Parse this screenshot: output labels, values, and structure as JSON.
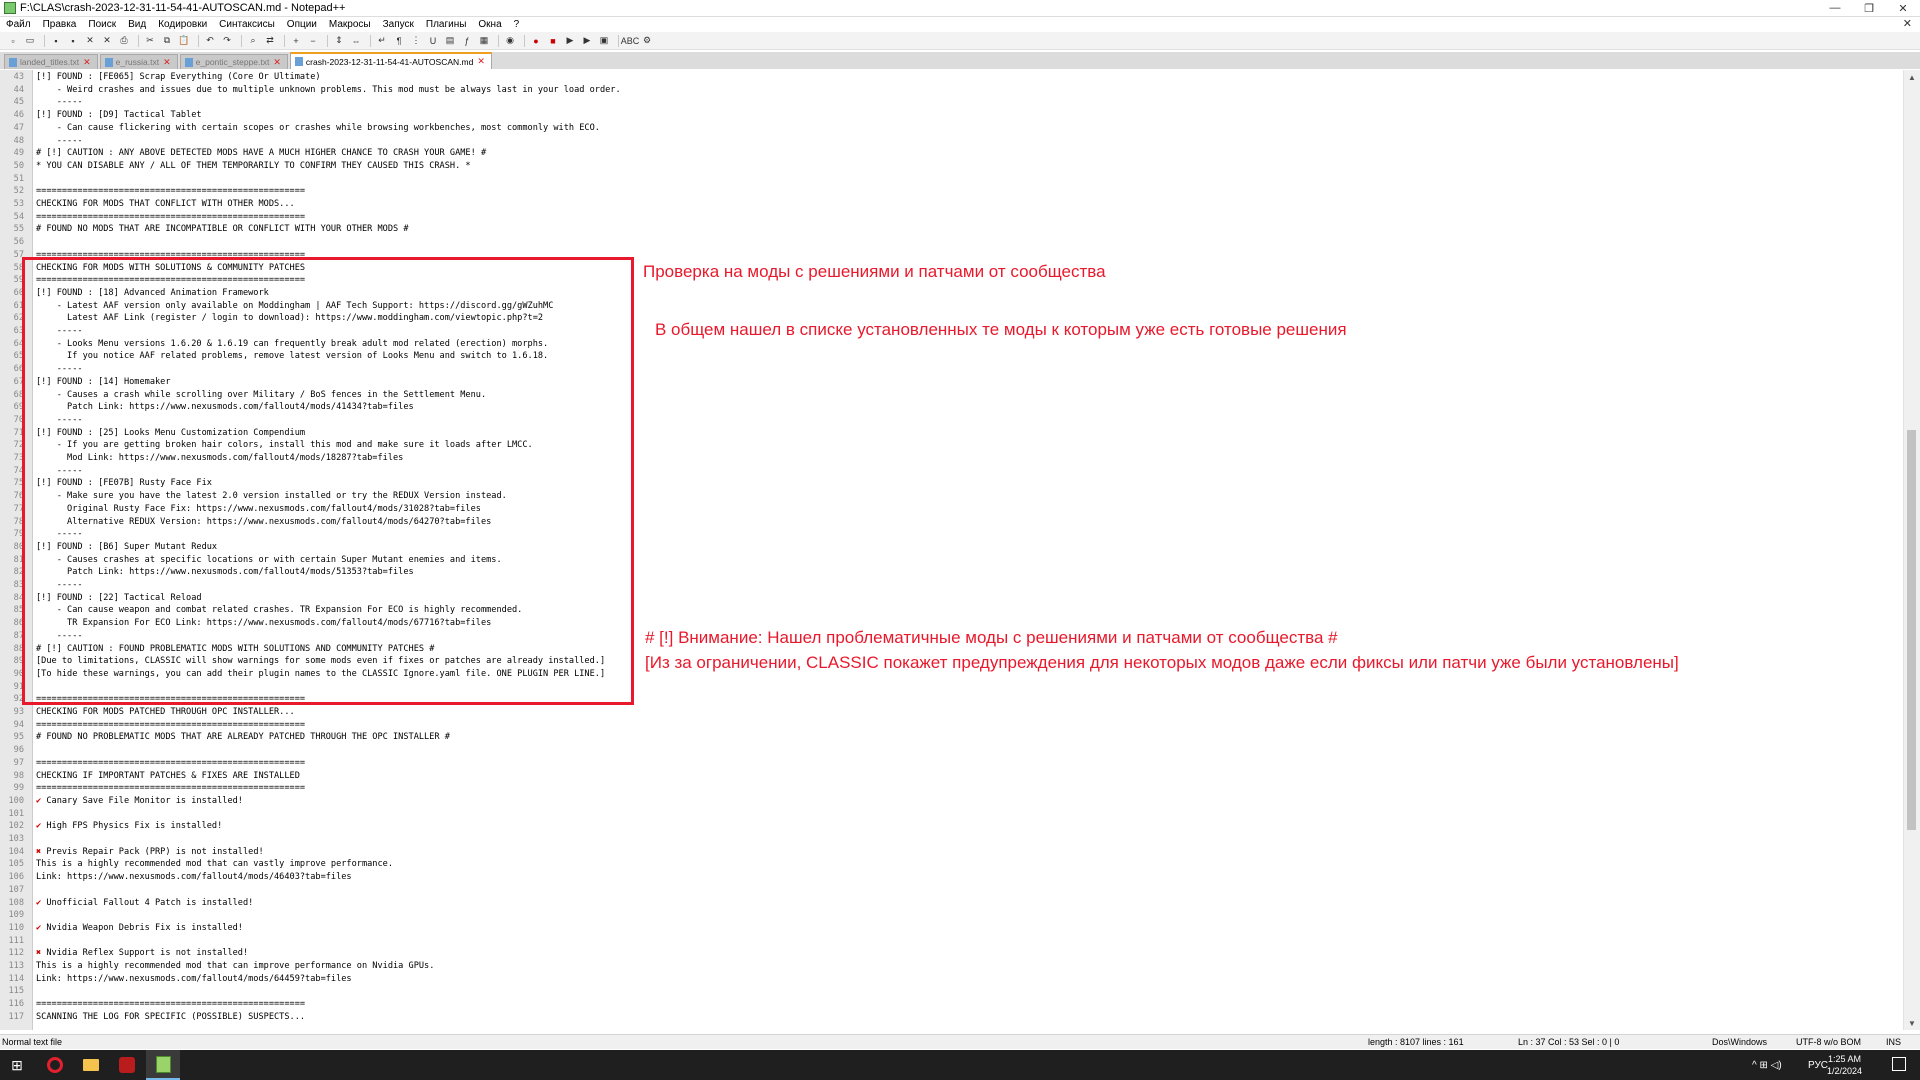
{
  "window": {
    "title": "F:\\CLAS\\crash-2023-12-31-11-54-41-AUTOSCAN.md - Notepad++",
    "minimize": "—",
    "maximize": "❐",
    "close": "✕"
  },
  "menu": {
    "items": [
      "Файл",
      "Правка",
      "Поиск",
      "Вид",
      "Кодировки",
      "Синтаксисы",
      "Опции",
      "Макросы",
      "Запуск",
      "Плагины",
      "Окна",
      "?"
    ],
    "close_doc": "✕"
  },
  "toolbar": {
    "icons": [
      "new-file-icon",
      "open-file-icon",
      "save-icon",
      "save-all-icon",
      "close-icon",
      "close-all-icon",
      "print-icon",
      "cut-icon",
      "copy-icon",
      "paste-icon",
      "undo-icon",
      "redo-icon",
      "find-icon",
      "replace-icon",
      "zoom-in-icon",
      "zoom-out-icon",
      "sync-v-icon",
      "sync-h-icon",
      "wrap-icon",
      "all-chars-icon",
      "indent-guide-icon",
      "udl-icon",
      "doc-map-icon",
      "function-list-icon",
      "folder-as-workspace-icon",
      "monitor-icon",
      "record-icon",
      "stop-icon",
      "play-icon",
      "play-multiple-icon",
      "save-macro-icon",
      "spellcheck-icon",
      "plugin-icon"
    ]
  },
  "tabs": [
    {
      "label": "landed_titles.txt",
      "active": false
    },
    {
      "label": "e_russia.txt",
      "active": false
    },
    {
      "label": "e_pontic_steppe.txt",
      "active": false
    },
    {
      "label": "crash-2023-12-31-11-54-41-AUTOSCAN.md",
      "active": true
    }
  ],
  "lines": [
    {
      "n": "43",
      "t": "[!] FOUND : [FE065] Scrap Everything (Core Or Ultimate)"
    },
    {
      "n": "44",
      "t": "    - Weird crashes and issues due to multiple unknown problems. This mod must be always last in your load order."
    },
    {
      "n": "45",
      "t": "    -----"
    },
    {
      "n": "46",
      "t": "[!] FOUND : [D9] Tactical Tablet"
    },
    {
      "n": "47",
      "t": "    - Can cause flickering with certain scopes or crashes while browsing workbenches, most commonly with ECO."
    },
    {
      "n": "48",
      "t": "    -----"
    },
    {
      "n": "49",
      "t": "# [!] CAUTION : ANY ABOVE DETECTED MODS HAVE A MUCH HIGHER CHANCE TO CRASH YOUR GAME! #"
    },
    {
      "n": "50",
      "t": "* YOU CAN DISABLE ANY / ALL OF THEM TEMPORARILY TO CONFIRM THEY CAUSED THIS CRASH. *"
    },
    {
      "n": "51",
      "t": ""
    },
    {
      "n": "52",
      "t": "===================================================="
    },
    {
      "n": "53",
      "t": "CHECKING FOR MODS THAT CONFLICT WITH OTHER MODS..."
    },
    {
      "n": "54",
      "t": "===================================================="
    },
    {
      "n": "55",
      "t": "# FOUND NO MODS THAT ARE INCOMPATIBLE OR CONFLICT WITH YOUR OTHER MODS #"
    },
    {
      "n": "56",
      "t": ""
    },
    {
      "n": "57",
      "t": "===================================================="
    },
    {
      "n": "58",
      "t": "CHECKING FOR MODS WITH SOLUTIONS & COMMUNITY PATCHES"
    },
    {
      "n": "59",
      "t": "===================================================="
    },
    {
      "n": "60",
      "t": "[!] FOUND : [18] Advanced Animation Framework"
    },
    {
      "n": "61",
      "t": "    - Latest AAF version only available on Moddingham | AAF Tech Support: https://discord.gg/gWZuhMC"
    },
    {
      "n": "62",
      "t": "      Latest AAF Link (register / login to download): https://www.moddingham.com/viewtopic.php?t=2"
    },
    {
      "n": "63",
      "t": "    -----"
    },
    {
      "n": "64",
      "t": "    - Looks Menu versions 1.6.20 & 1.6.19 can frequently break adult mod related (erection) morphs."
    },
    {
      "n": "65",
      "t": "      If you notice AAF related problems, remove latest version of Looks Menu and switch to 1.6.18."
    },
    {
      "n": "66",
      "t": "    -----"
    },
    {
      "n": "67",
      "t": "[!] FOUND : [14] Homemaker"
    },
    {
      "n": "68",
      "t": "    - Causes a crash while scrolling over Military / BoS fences in the Settlement Menu."
    },
    {
      "n": "69",
      "t": "      Patch Link: https://www.nexusmods.com/fallout4/mods/41434?tab=files"
    },
    {
      "n": "70",
      "t": "    -----"
    },
    {
      "n": "71",
      "t": "[!] FOUND : [25] Looks Menu Customization Compendium"
    },
    {
      "n": "72",
      "t": "    - If you are getting broken hair colors, install this mod and make sure it loads after LMCC."
    },
    {
      "n": "73",
      "t": "      Mod Link: https://www.nexusmods.com/fallout4/mods/18287?tab=files"
    },
    {
      "n": "74",
      "t": "    -----"
    },
    {
      "n": "75",
      "t": "[!] FOUND : [FE07B] Rusty Face Fix"
    },
    {
      "n": "76",
      "t": "    - Make sure you have the latest 2.0 version installed or try the REDUX Version instead."
    },
    {
      "n": "77",
      "t": "      Original Rusty Face Fix: https://www.nexusmods.com/fallout4/mods/31028?tab=files"
    },
    {
      "n": "78",
      "t": "      Alternative REDUX Version: https://www.nexusmods.com/fallout4/mods/64270?tab=files"
    },
    {
      "n": "79",
      "t": "    -----"
    },
    {
      "n": "80",
      "t": "[!] FOUND : [B6] Super Mutant Redux"
    },
    {
      "n": "81",
      "t": "    - Causes crashes at specific locations or with certain Super Mutant enemies and items."
    },
    {
      "n": "82",
      "t": "      Patch Link: https://www.nexusmods.com/fallout4/mods/51353?tab=files"
    },
    {
      "n": "83",
      "t": "    -----"
    },
    {
      "n": "84",
      "t": "[!] FOUND : [22] Tactical Reload"
    },
    {
      "n": "85",
      "t": "    - Can cause weapon and combat related crashes. TR Expansion For ECO is highly recommended."
    },
    {
      "n": "86",
      "t": "      TR Expansion For ECO Link: https://www.nexusmods.com/fallout4/mods/67716?tab=files"
    },
    {
      "n": "87",
      "t": "    -----"
    },
    {
      "n": "88",
      "t": "# [!] CAUTION : FOUND PROBLEMATIC MODS WITH SOLUTIONS AND COMMUNITY PATCHES #"
    },
    {
      "n": "89",
      "t": "[Due to limitations, CLASSIC will show warnings for some mods even if fixes or patches are already installed.]"
    },
    {
      "n": "90",
      "t": "[To hide these warnings, you can add their plugin names to the CLASSIC Ignore.yaml file. ONE PLUGIN PER LINE.]"
    },
    {
      "n": "91",
      "t": ""
    },
    {
      "n": "92",
      "t": "===================================================="
    },
    {
      "n": "93",
      "t": "CHECKING FOR MODS PATCHED THROUGH OPC INSTALLER..."
    },
    {
      "n": "94",
      "t": "===================================================="
    },
    {
      "n": "95",
      "t": "# FOUND NO PROBLEMATIC MODS THAT ARE ALREADY PATCHED THROUGH THE OPC INSTALLER #"
    },
    {
      "n": "96",
      "t": ""
    },
    {
      "n": "97",
      "t": "===================================================="
    },
    {
      "n": "98",
      "t": "CHECKING IF IMPORTANT PATCHES & FIXES ARE INSTALLED"
    },
    {
      "n": "99",
      "t": "===================================================="
    },
    {
      "n": "100",
      "t": "✔ Canary Save File Monitor is installed!"
    },
    {
      "n": "101",
      "t": ""
    },
    {
      "n": "102",
      "t": "✔ High FPS Physics Fix is installed!"
    },
    {
      "n": "103",
      "t": ""
    },
    {
      "n": "104",
      "t": "✖ Previs Repair Pack (PRP) is not installed!"
    },
    {
      "n": "105",
      "t": "This is a highly recommended mod that can vastly improve performance."
    },
    {
      "n": "106",
      "t": "Link: https://www.nexusmods.com/fallout4/mods/46403?tab=files"
    },
    {
      "n": "107",
      "t": ""
    },
    {
      "n": "108",
      "t": "✔ Unofficial Fallout 4 Patch is installed!"
    },
    {
      "n": "109",
      "t": ""
    },
    {
      "n": "110",
      "t": "✔ Nvidia Weapon Debris Fix is installed!"
    },
    {
      "n": "111",
      "t": ""
    },
    {
      "n": "112",
      "t": "✖ Nvidia Reflex Support is not installed!"
    },
    {
      "n": "113",
      "t": "This is a highly recommended mod that can improve performance on Nvidia GPUs."
    },
    {
      "n": "114",
      "t": "Link: https://www.nexusmods.com/fallout4/mods/64459?tab=files"
    },
    {
      "n": "115",
      "t": ""
    },
    {
      "n": "116",
      "t": "===================================================="
    },
    {
      "n": "117",
      "t": "SCANNING THE LOG FOR SPECIFIC (POSSIBLE) SUSPECTS..."
    }
  ],
  "annotations": {
    "a1": "Проверка на моды с решениями и патчами от сообщества",
    "a2": "В общем нашел в списке установленных те моды к которым уже есть готовые решения",
    "a3": "# [!] Внимание: Нашел проблематичные моды с решениями и патчами от сообщества #",
    "a4": "[Из за ограничении, CLASSIC покажет предупреждения для некоторых модов даже если фиксы или патчи уже были установлены]"
  },
  "status": {
    "filetype": "Normal text file",
    "length": "length : 8107    lines : 161",
    "position": "Ln : 37    Col : 53    Sel : 0 | 0",
    "eol": "Dos\\Windows",
    "encoding": "UTF-8 w/o BOM",
    "mode": "INS"
  },
  "taskbar": {
    "time": "1:25 AM",
    "date": "1/2/2024",
    "lang": "РУС",
    "tray_icons": "^  ⊞  ◁)"
  },
  "colors": {
    "annotation_red": "#e8192c",
    "check_red": "#cc0000"
  }
}
